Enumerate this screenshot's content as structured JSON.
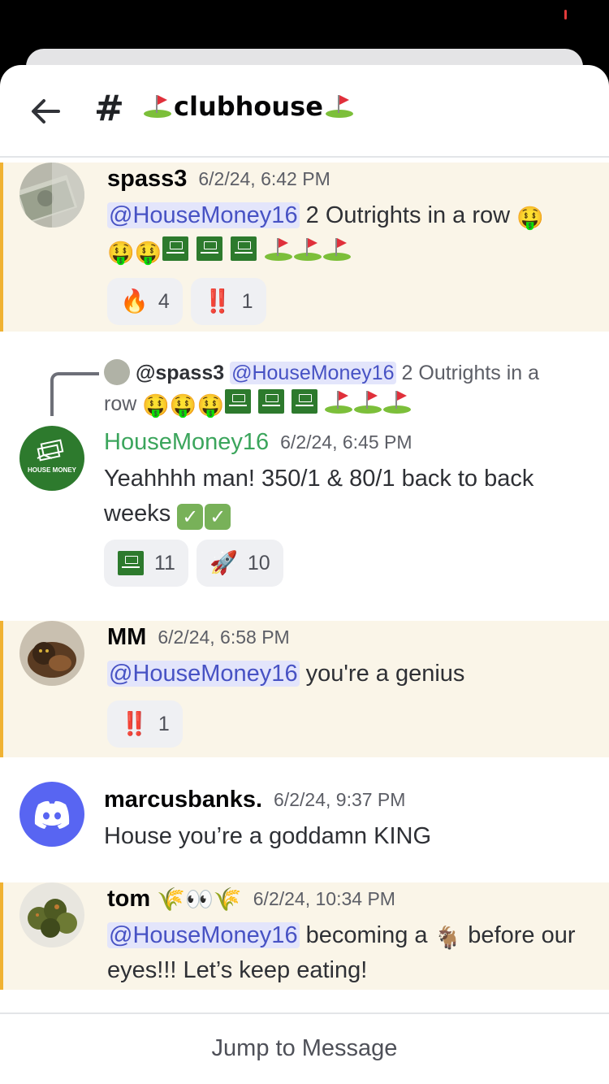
{
  "header": {
    "hash": "#",
    "channel_name": "clubhouse"
  },
  "messages": [
    {
      "author": "spass3",
      "time": "6/2/24, 6:42 PM",
      "mention": "@HouseMoney16",
      "text": " 2 Outrights in a row ",
      "reactions": [
        {
          "emoji": "🔥",
          "count": "4"
        },
        {
          "emoji": "‼️",
          "count": "1"
        }
      ]
    },
    {
      "reply_author": "@spass3",
      "reply_mention": "@HouseMoney16",
      "reply_text": " 2 Outrights in a row ",
      "author": "HouseMoney16",
      "author_color": "#3ba55c",
      "time": "6/2/24, 6:45 PM",
      "text": "Yeahhhh man! 350/1 & 80/1 back to back weeks ",
      "reactions": [
        {
          "emoji": "house-money-badge",
          "count": "11"
        },
        {
          "emoji": "🚀",
          "count": "10"
        }
      ]
    },
    {
      "author": "MM",
      "time": "6/2/24, 6:58 PM",
      "mention": "@HouseMoney16",
      "text": " you're a genius",
      "reactions": [
        {
          "emoji": "‼️",
          "count": "1"
        }
      ]
    },
    {
      "author": "marcusbanks.",
      "time": "6/2/24, 9:37 PM",
      "text": "House you’re a goddamn KING"
    },
    {
      "author": "tom",
      "author_suffix": "🌾👀🌾",
      "time": "6/2/24, 10:34 PM",
      "mention": "@HouseMoney16",
      "text_a": " becoming a ",
      "text_b": " before our eyes!!! Let’s keep eating!"
    }
  ],
  "footer": {
    "jump_label": "Jump to Message"
  },
  "colors": {
    "highlight_bg": "#faf5e8",
    "highlight_bar": "#f0b232",
    "mention_bg": "#e3e5fb",
    "mention_text": "#4752c4",
    "discord_blurple": "#5865f2",
    "house_green": "#2d7a2d"
  },
  "avatar_labels": {
    "house_money": "HOUSE MONEY"
  }
}
